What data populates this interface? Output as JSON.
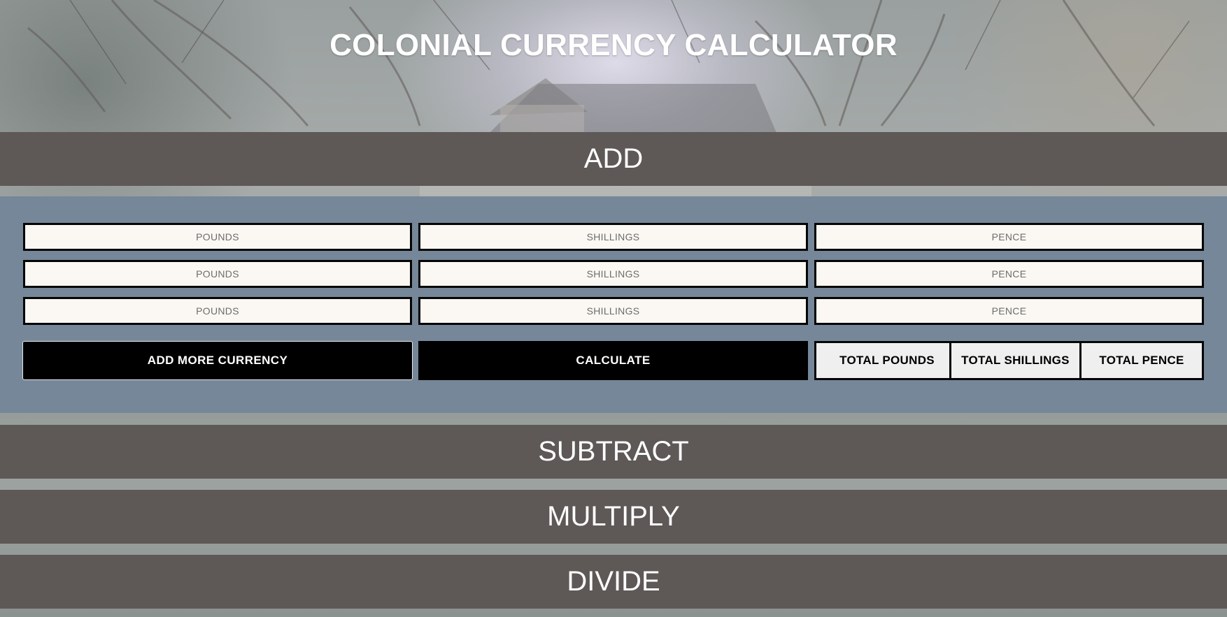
{
  "header": {
    "title": "COLONIAL CURRENCY CALCULATOR"
  },
  "sections": {
    "add": "ADD",
    "subtract": "SUBTRACT",
    "multiply": "MULTIPLY",
    "divide": "DIVIDE"
  },
  "add_panel": {
    "rows": [
      {
        "pounds_placeholder": "POUNDS",
        "shillings_placeholder": "SHILLINGS",
        "pence_placeholder": "PENCE"
      },
      {
        "pounds_placeholder": "POUNDS",
        "shillings_placeholder": "SHILLINGS",
        "pence_placeholder": "PENCE"
      },
      {
        "pounds_placeholder": "POUNDS",
        "shillings_placeholder": "SHILLINGS",
        "pence_placeholder": "PENCE"
      }
    ],
    "add_more_label": "ADD MORE CURRENCY",
    "calculate_label": "CALCULATE",
    "totals": {
      "pounds": "TOTAL POUNDS",
      "shillings": "TOTAL SHILLINGS",
      "pence": "TOTAL PENCE"
    }
  },
  "colors": {
    "section_bar": "#5e5857",
    "panel": "#758799",
    "field_bg": "#fbf8f3",
    "button": "#000000"
  }
}
